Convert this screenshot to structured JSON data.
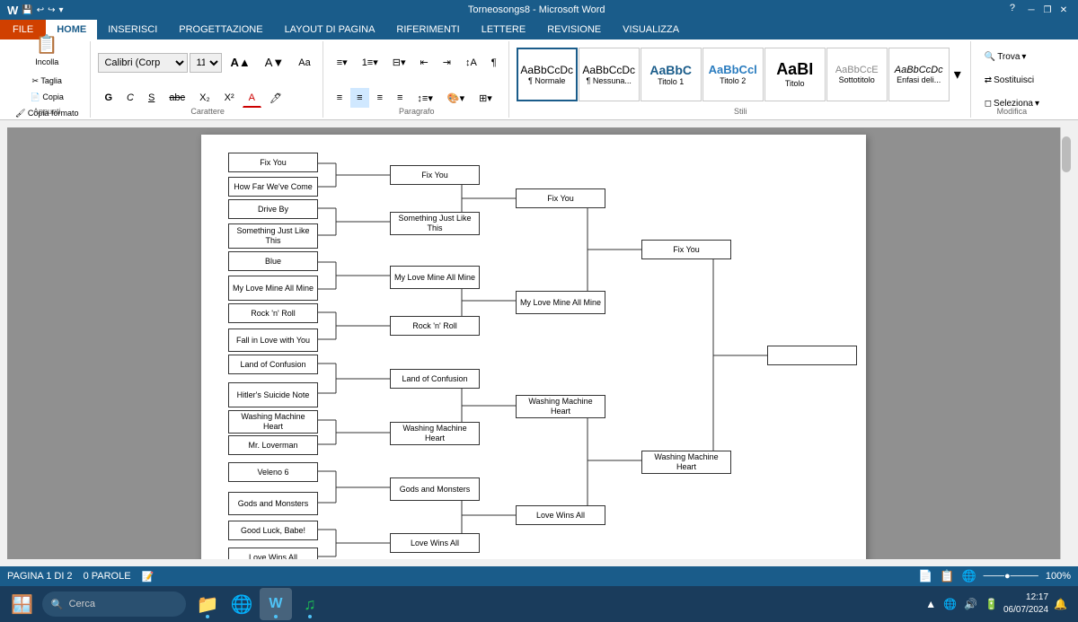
{
  "titlebar": {
    "title": "Torneosongs8 - Microsoft Word",
    "help": "?",
    "left_icons": [
      "💾",
      "↩",
      "↪"
    ]
  },
  "ribbon": {
    "tabs": [
      "FILE",
      "HOME",
      "INSERISCI",
      "PROGETTAZIONE",
      "LAYOUT DI PAGINA",
      "RIFERIMENTI",
      "LETTERE",
      "REVISIONE",
      "VISUALIZZA"
    ]
  },
  "toolbar": {
    "font_name": "Calibri (Corp",
    "font_size": "11",
    "styles": [
      {
        "label": "¶ Normale",
        "class": "active"
      },
      {
        "label": "¶ Nessuna...",
        "class": ""
      },
      {
        "label": "Titolo 1",
        "class": ""
      },
      {
        "label": "Titolo 2",
        "class": ""
      },
      {
        "label": "Titolo",
        "class": ""
      },
      {
        "label": "Sottotitolo",
        "class": ""
      },
      {
        "label": "Enfasi deli...",
        "class": ""
      }
    ],
    "modifica": {
      "trova": "Trova",
      "sostituisci": "Sostituisci",
      "seleziona": "Seleziona"
    }
  },
  "bracket": {
    "round1": [
      {
        "id": "r1_1",
        "text": "Fix You"
      },
      {
        "id": "r1_2",
        "text": "How Far We've Come"
      },
      {
        "id": "r1_3",
        "text": "Drive By"
      },
      {
        "id": "r1_4",
        "text": "Something Just Like This"
      },
      {
        "id": "r1_5",
        "text": "Blue"
      },
      {
        "id": "r1_6",
        "text": "My Love Mine All Mine"
      },
      {
        "id": "r1_7",
        "text": "Rock 'n' Roll"
      },
      {
        "id": "r1_8",
        "text": "Fall in Love with You"
      },
      {
        "id": "r1_9",
        "text": "Land of Confusion"
      },
      {
        "id": "r1_10",
        "text": "Hitler's Suicide Note"
      },
      {
        "id": "r1_11",
        "text": "Washing Machine Heart"
      },
      {
        "id": "r1_12",
        "text": "Mr. Loverman"
      },
      {
        "id": "r1_13",
        "text": "Veleno 6"
      },
      {
        "id": "r1_14",
        "text": "Gods and Monsters"
      },
      {
        "id": "r1_15",
        "text": "Good Luck, Babe!"
      },
      {
        "id": "r1_16",
        "text": "Love Wins All"
      }
    ],
    "round2": [
      {
        "id": "r2_1",
        "text": "Fix You"
      },
      {
        "id": "r2_2",
        "text": "Something Just Like This"
      },
      {
        "id": "r2_3",
        "text": "My Love Mine All Mine"
      },
      {
        "id": "r2_4",
        "text": "Rock 'n' Roll"
      },
      {
        "id": "r2_5",
        "text": "Land of Confusion"
      },
      {
        "id": "r2_6",
        "text": "Washing Machine Heart"
      },
      {
        "id": "r2_7",
        "text": "Gods and Monsters"
      },
      {
        "id": "r2_8",
        "text": "Love Wins All"
      }
    ],
    "round3": [
      {
        "id": "r3_1",
        "text": "Fix You"
      },
      {
        "id": "r3_2",
        "text": "My Love Mine All Mine"
      },
      {
        "id": "r3_3",
        "text": "Washing Machine Heart"
      },
      {
        "id": "r3_4",
        "text": "Love Wins All"
      }
    ],
    "round4": [
      {
        "id": "r4_1",
        "text": "Fix You"
      },
      {
        "id": "r4_2",
        "text": "Washing Machine Heart"
      }
    ],
    "final": [
      {
        "id": "r5_1",
        "text": ""
      }
    ]
  },
  "statusbar": {
    "page_info": "PAGINA 1 DI 2",
    "word_count": "0 PAROLE",
    "zoom": "100%"
  },
  "taskbar": {
    "search_placeholder": "Cerca",
    "time": "12:17",
    "date": "06/07/2024",
    "apps": [
      "🪟",
      "📁",
      "🌐",
      "W",
      "🎵"
    ]
  }
}
